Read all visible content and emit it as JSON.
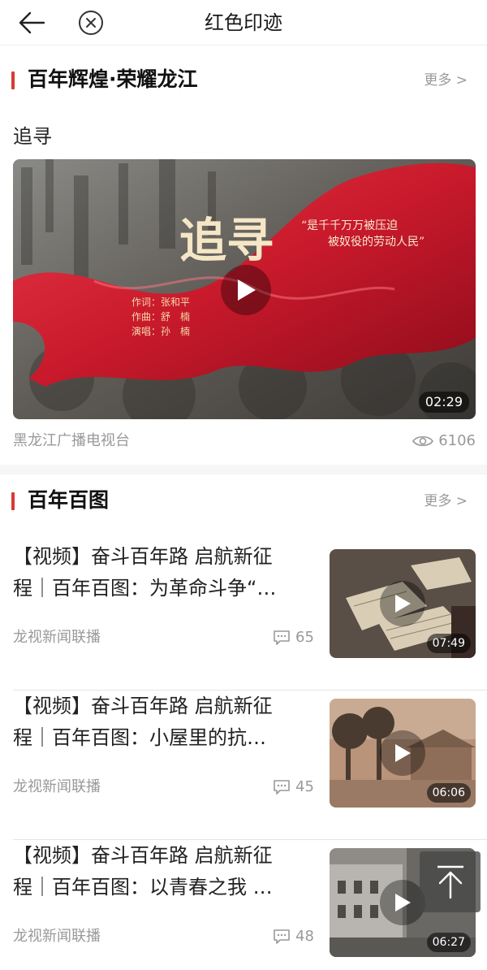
{
  "header": {
    "title": "红色印迹",
    "back_icon": "back-arrow-icon",
    "close_icon": "close-circle-icon"
  },
  "section1": {
    "title": "百年辉煌·荣耀龙江",
    "more": "更多 >",
    "subtitle": "追寻",
    "video": {
      "duration": "02:29",
      "big_title": "追寻",
      "quote_line1": "“是千千万万被压迫",
      "quote_line2": "被奴役的劳动人民”",
      "credits": [
        "作词：张和平",
        "作曲：舒　楠",
        "演唱：孙　楠"
      ]
    },
    "source": "黑龙江广播电视台",
    "views": "6106"
  },
  "section2": {
    "title": "百年百图",
    "more": "更多 >",
    "articles": [
      {
        "title_line1": "【视频】奋斗百年路 启航新征",
        "title_line2": "程｜百年百图：为革命斗争“…",
        "source": "龙视新闻联播",
        "comments": "65",
        "duration": "07:49"
      },
      {
        "title_line1": "【视频】奋斗百年路 启航新征",
        "title_line2": "程｜百年百图：小屋里的抗…",
        "source": "龙视新闻联播",
        "comments": "45",
        "duration": "06:06"
      },
      {
        "title_line1": "【视频】奋斗百年路 启航新征",
        "title_line2": "程｜百年百图：以青春之我 …",
        "source": "龙视新闻联播",
        "comments": "48",
        "duration": "06:27"
      }
    ]
  },
  "colors": {
    "accent": "#d83a34",
    "muted": "#999999"
  }
}
